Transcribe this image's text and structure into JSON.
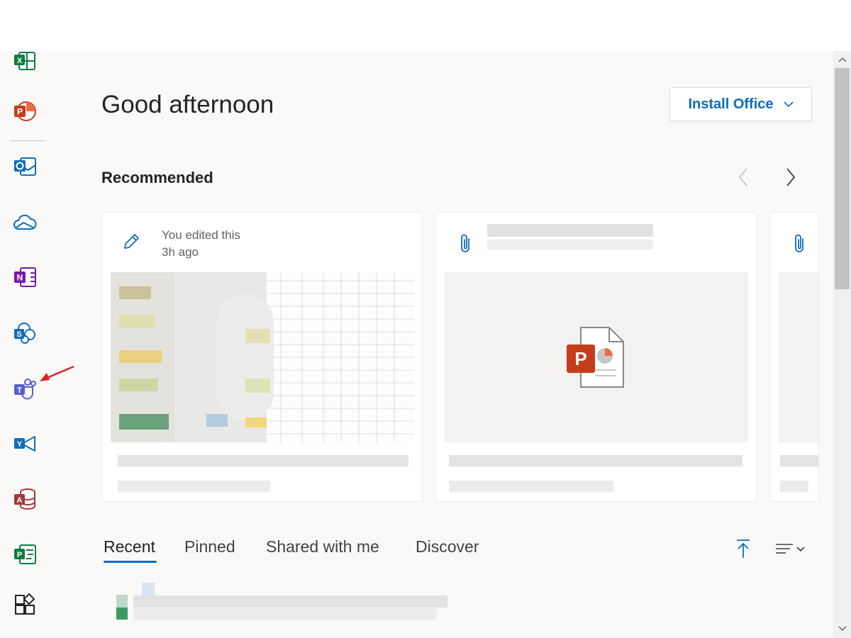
{
  "greeting": "Good afternoon",
  "install_button": {
    "label": "Install Office"
  },
  "recommended": {
    "title": "Recommended",
    "cards": [
      {
        "meta_line1": "You edited this",
        "meta_line2": "3h ago",
        "icon": "pencil-icon"
      },
      {
        "meta_line1": "",
        "meta_line2": "",
        "icon": "paperclip-icon",
        "file_type": "powerpoint"
      },
      {
        "icon": "paperclip-icon"
      }
    ]
  },
  "rail_apps": [
    "excel-icon",
    "powerpoint-icon",
    "outlook-icon",
    "onedrive-icon",
    "onenote-icon",
    "sharepoint-icon",
    "teams-icon",
    "yammer-icon",
    "access-icon",
    "project-icon",
    "all-apps-icon"
  ],
  "tabs": [
    {
      "label": "Recent",
      "active": true
    },
    {
      "label": "Pinned",
      "active": false
    },
    {
      "label": "Shared with me",
      "active": false
    },
    {
      "label": "Discover",
      "active": false
    }
  ],
  "colors": {
    "accent": "#0f6cbd",
    "powerpoint": "#c43e1c",
    "excel": "#107c41",
    "outlook": "#0f6cbd",
    "teams": "#5b5fc7",
    "onenote": "#7719aa",
    "access": "#a4373a",
    "annotation": "#e02020"
  }
}
